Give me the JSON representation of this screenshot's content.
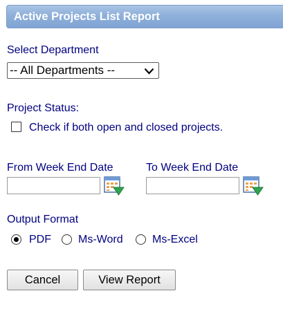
{
  "header": {
    "title": "Active Projects List Report"
  },
  "department": {
    "label": "Select Department",
    "selected": "-- All Departments --"
  },
  "status": {
    "label": "Project Status:",
    "checkbox_label": "Check if both open and closed projects.",
    "checked": false
  },
  "dates": {
    "from_label": "From Week End Date",
    "to_label": "To Week End Date",
    "from_value": "",
    "to_value": ""
  },
  "output": {
    "label": "Output Format",
    "options": [
      "PDF",
      "Ms-Word",
      "Ms-Excel"
    ],
    "selected": "PDF"
  },
  "buttons": {
    "cancel": "Cancel",
    "view_report": "View Report"
  },
  "icons": {
    "date_picker": "calendar-dropdown-icon",
    "select_arrow": "chevron-down-icon"
  }
}
